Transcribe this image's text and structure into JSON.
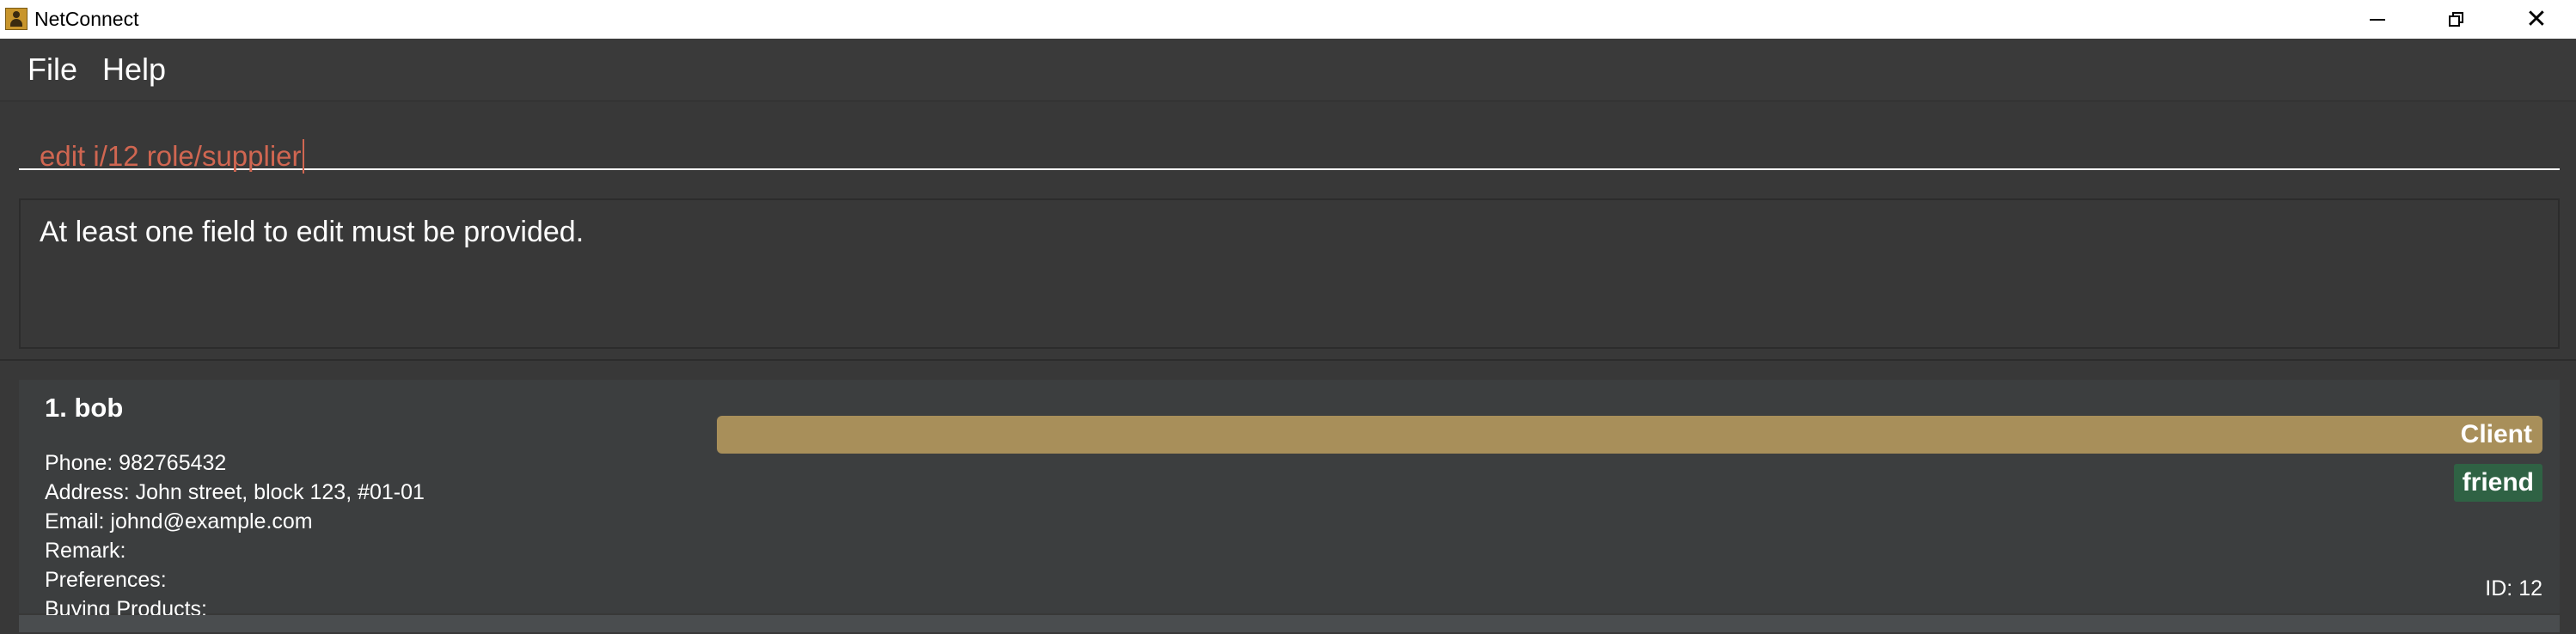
{
  "window": {
    "title": "NetConnect",
    "controls": {
      "minimize": "—",
      "close": "✕"
    }
  },
  "menu": {
    "items": [
      "File",
      "Help"
    ]
  },
  "command_box": {
    "value": "edit i/12 role/supplier"
  },
  "result_display": {
    "message": "At least one field to edit must be provided."
  },
  "person_list": {
    "cards": [
      {
        "index_name": "1.  bob",
        "phone": "Phone: 982765432",
        "address": "Address: John street, block 123, #01-01",
        "email": "Email: johnd@example.com",
        "remark": "Remark:",
        "preferences": "Preferences:",
        "buying_products": "Buying Products:",
        "role": "Client",
        "tags": [
          "friend"
        ],
        "id": "ID: 12"
      }
    ]
  },
  "colors": {
    "command_text": "#d06651",
    "role_client": "#a88f5a",
    "tag_friend": "#2f6244",
    "background": "#383838"
  }
}
